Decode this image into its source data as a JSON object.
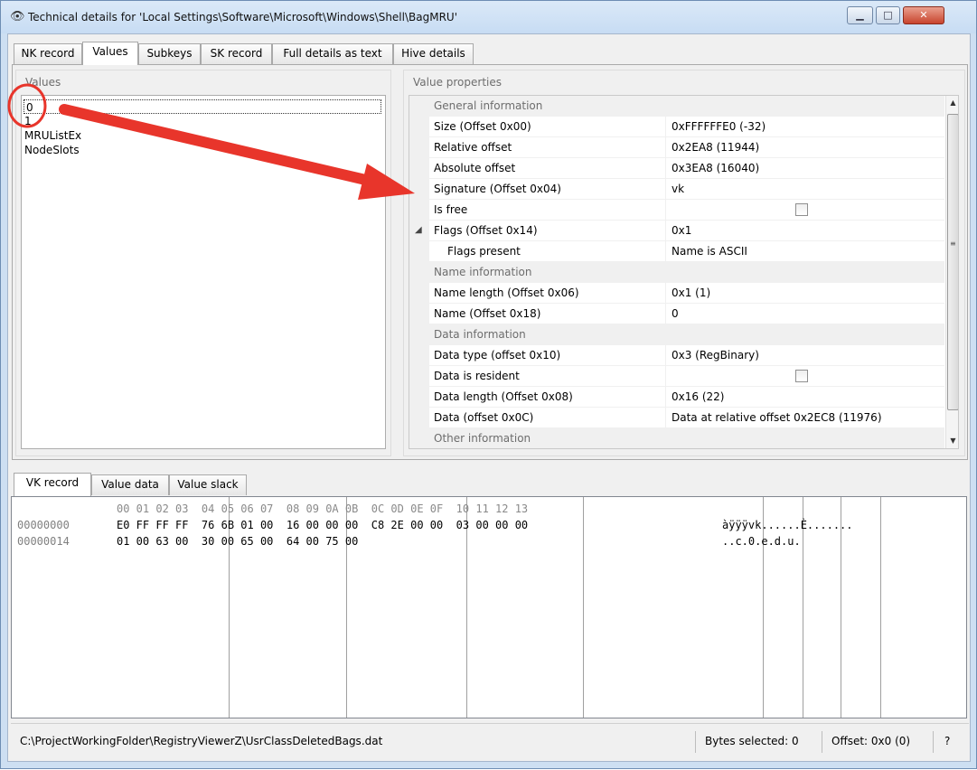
{
  "window": {
    "title": "Technical details for 'Local Settings\\Software\\Microsoft\\Windows\\Shell\\BagMRU'",
    "min_glyph": "▁",
    "max_glyph": "□",
    "close_glyph": "✕"
  },
  "top_tabs": [
    "NK record",
    "Values",
    "Subkeys",
    "SK record",
    "Full details as text",
    "Hive details"
  ],
  "top_tabs_active": "Values",
  "values_panel": {
    "caption": "Values",
    "items": [
      "0",
      "1",
      "MRUListEx",
      "NodeSlots"
    ],
    "selected": "0"
  },
  "properties_panel": {
    "caption": "Value properties",
    "rows": [
      {
        "kind": "category",
        "label": "General information"
      },
      {
        "kind": "prop",
        "key": "Size (Offset 0x00)",
        "value": "0xFFFFFFE0 (-32)"
      },
      {
        "kind": "prop",
        "key": "Relative offset",
        "value": "0x2EA8 (11944)"
      },
      {
        "kind": "prop",
        "key": "Absolute offset",
        "value": "0x3EA8 (16040)"
      },
      {
        "kind": "prop",
        "key": "Signature (Offset 0x04)",
        "value": "vk"
      },
      {
        "kind": "check",
        "key": "Is free",
        "checked": false
      },
      {
        "kind": "expand",
        "key": "Flags (Offset 0x14)",
        "value": "0x1"
      },
      {
        "kind": "sub",
        "key": "Flags present",
        "value": "Name is ASCII"
      },
      {
        "kind": "category",
        "label": "Name information"
      },
      {
        "kind": "prop",
        "key": "Name length (Offset 0x06)",
        "value": "0x1 (1)"
      },
      {
        "kind": "prop",
        "key": "Name (Offset 0x18)",
        "value": "0"
      },
      {
        "kind": "category",
        "label": "Data information"
      },
      {
        "kind": "prop",
        "key": "Data type (offset 0x10)",
        "value": "0x3 (RegBinary)"
      },
      {
        "kind": "check",
        "key": "Data is resident",
        "checked": false
      },
      {
        "kind": "prop",
        "key": "Data length (Offset 0x08)",
        "value": "0x16 (22)"
      },
      {
        "kind": "prop",
        "key": "Data (offset 0x0C)",
        "value": "Data at relative offset 0x2EC8 (11976)"
      },
      {
        "kind": "category",
        "label": "Other information"
      }
    ]
  },
  "bottom_tabs": [
    "VK record",
    "Value data",
    "Value slack"
  ],
  "bottom_tabs_active": "VK record",
  "hex": {
    "header": "00 01 02 03  04 05 06 07  08 09 0A 0B  0C 0D 0E 0F  10 11 12 13",
    "rows": [
      {
        "offset": "00000000",
        "bytes": "E0 FF FF FF  76 6B 01 00  16 00 00 00  C8 2E 00 00  03 00 00 00",
        "ascii": "àÿÿÿvk......È......."
      },
      {
        "offset": "00000014",
        "bytes": "01 00 63 00  30 00 65 00  64 00 75 00",
        "ascii": "..c.0.e.d.u."
      }
    ]
  },
  "status": {
    "path": "C:\\ProjectWorkingFolder\\RegistryViewerZ\\UsrClassDeletedBags.dat",
    "bytes_selected": "Bytes selected: 0",
    "offset": "Offset: 0x0 (0)",
    "help": "?"
  },
  "colors": {
    "annotation": "#e8352b",
    "selection": "#cfe4fa"
  }
}
